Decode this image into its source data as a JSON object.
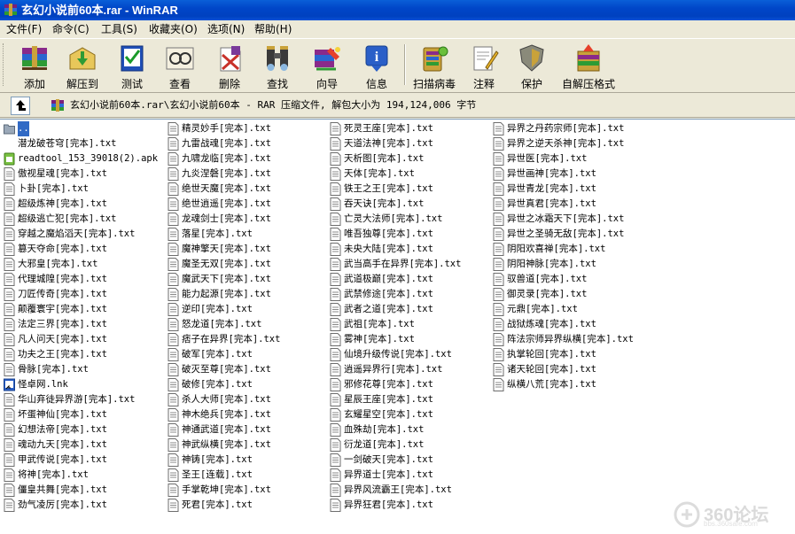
{
  "window": {
    "title": "玄幻小说前60本.rar - WinRAR"
  },
  "menu": [
    {
      "label": "文件(F)",
      "name": "menu-file"
    },
    {
      "label": "命令(C)",
      "name": "menu-command"
    },
    {
      "label": "工具(S)",
      "name": "menu-tools"
    },
    {
      "label": "收藏夹(O)",
      "name": "menu-favorites"
    },
    {
      "label": "选项(N)",
      "name": "menu-options"
    },
    {
      "label": "帮助(H)",
      "name": "menu-help"
    }
  ],
  "toolbar": {
    "add": "添加",
    "extract_to": "解压到",
    "test": "测试",
    "view": "查看",
    "delete": "删除",
    "find": "查找",
    "wizard": "向导",
    "info": "信息",
    "scan": "扫描病毒",
    "comment": "注释",
    "protect": "保护",
    "sfx": "自解压格式"
  },
  "address": {
    "path": "玄幻小说前60本.rar\\玄幻小说前60本 - RAR 压缩文件, 解包大小为 194,124,006 字节"
  },
  "files": {
    "col1": [
      {
        "name": "..",
        "icon": "folder-up-icon"
      },
      {
        "name": "潜龙破苍穹[完本].txt",
        "icon": "blank-icon"
      },
      {
        "name": "readtool_153_39018(2).apk",
        "icon": "android-icon"
      },
      {
        "name": "傲视星魂[完本].txt",
        "icon": "text-file-icon"
      },
      {
        "name": "卜卦[完本].txt",
        "icon": "text-file-icon"
      },
      {
        "name": "超级炼神[完本].txt",
        "icon": "text-file-icon"
      },
      {
        "name": "超级逃亡犯[完本].txt",
        "icon": "text-file-icon"
      },
      {
        "name": "穿越之魔焰滔天[完本].txt",
        "icon": "text-file-icon"
      },
      {
        "name": "篡天夺命[完本].txt",
        "icon": "text-file-icon"
      },
      {
        "name": "大邪皇[完本].txt",
        "icon": "text-file-icon"
      },
      {
        "name": "代理城隍[完本].txt",
        "icon": "text-file-icon"
      },
      {
        "name": "刀匠传奇[完本].txt",
        "icon": "text-file-icon"
      },
      {
        "name": "颠覆寰宇[完本].txt",
        "icon": "text-file-icon"
      },
      {
        "name": "法定三界[完本].txt",
        "icon": "text-file-icon"
      },
      {
        "name": "凡人问天[完本].txt",
        "icon": "text-file-icon"
      },
      {
        "name": "功夫之王[完本].txt",
        "icon": "text-file-icon"
      },
      {
        "name": "骨脉[完本].txt",
        "icon": "text-file-icon"
      },
      {
        "name": "怪卓网.lnk",
        "icon": "shortcut-icon"
      },
      {
        "name": "华山弃徒异界游[完本].txt",
        "icon": "text-file-icon"
      },
      {
        "name": "坏蛋神仙[完本].txt",
        "icon": "text-file-icon"
      },
      {
        "name": "幻想法帝[完本].txt",
        "icon": "text-file-icon"
      },
      {
        "name": "魂动九天[完本].txt",
        "icon": "text-file-icon"
      },
      {
        "name": "甲武传说[完本].txt",
        "icon": "text-file-icon"
      },
      {
        "name": "将神[完本].txt",
        "icon": "text-file-icon"
      },
      {
        "name": "僵皇共舞[完本].txt",
        "icon": "text-file-icon"
      },
      {
        "name": "劲气凌厉[完本].txt",
        "icon": "text-file-icon"
      }
    ],
    "col2": [
      {
        "name": "精灵妙手[完本].txt",
        "icon": "text-file-icon"
      },
      {
        "name": "九雷战魂[完本].txt",
        "icon": "text-file-icon"
      },
      {
        "name": "九啸龙临[完本].txt",
        "icon": "text-file-icon"
      },
      {
        "name": "九炎涅磐[完本].txt",
        "icon": "text-file-icon"
      },
      {
        "name": "绝世天魔[完本].txt",
        "icon": "text-file-icon"
      },
      {
        "name": "绝世逍遥[完本].txt",
        "icon": "text-file-icon"
      },
      {
        "name": "龙魂剑士[完本].txt",
        "icon": "text-file-icon"
      },
      {
        "name": "落星[完本].txt",
        "icon": "text-file-icon"
      },
      {
        "name": "魔神擎天[完本].txt",
        "icon": "text-file-icon"
      },
      {
        "name": "魔圣无双[完本].txt",
        "icon": "text-file-icon"
      },
      {
        "name": "魔武天下[完本].txt",
        "icon": "text-file-icon"
      },
      {
        "name": "能力起源[完本].txt",
        "icon": "text-file-icon"
      },
      {
        "name": "逆印[完本].txt",
        "icon": "text-file-icon"
      },
      {
        "name": "怒龙道[完本].txt",
        "icon": "text-file-icon"
      },
      {
        "name": "痞子在异界[完本].txt",
        "icon": "text-file-icon"
      },
      {
        "name": "破军[完本].txt",
        "icon": "text-file-icon"
      },
      {
        "name": "破灭至尊[完本].txt",
        "icon": "text-file-icon"
      },
      {
        "name": "破修[完本].txt",
        "icon": "text-file-icon"
      },
      {
        "name": "杀人大师[完本].txt",
        "icon": "text-file-icon"
      },
      {
        "name": "神木绝兵[完本].txt",
        "icon": "text-file-icon"
      },
      {
        "name": "神通武道[完本].txt",
        "icon": "text-file-icon"
      },
      {
        "name": "神武纵横[完本].txt",
        "icon": "text-file-icon"
      },
      {
        "name": "神铸[完本].txt",
        "icon": "text-file-icon"
      },
      {
        "name": "圣王[连载].txt",
        "icon": "text-file-icon"
      },
      {
        "name": "手掌乾坤[完本].txt",
        "icon": "text-file-icon"
      },
      {
        "name": "死君[完本].txt",
        "icon": "text-file-icon"
      }
    ],
    "col3": [
      {
        "name": "死灵王座[完本].txt",
        "icon": "text-file-icon"
      },
      {
        "name": "天道法神[完本].txt",
        "icon": "text-file-icon"
      },
      {
        "name": "天析图[完本].txt",
        "icon": "text-file-icon"
      },
      {
        "name": "天体[完本].txt",
        "icon": "text-file-icon"
      },
      {
        "name": "铁王之王[完本].txt",
        "icon": "text-file-icon"
      },
      {
        "name": "吞天诀[完本].txt",
        "icon": "text-file-icon"
      },
      {
        "name": "亡灵大法师[完本].txt",
        "icon": "text-file-icon"
      },
      {
        "name": "唯吾独尊[完本].txt",
        "icon": "text-file-icon"
      },
      {
        "name": "未央大陆[完本].txt",
        "icon": "text-file-icon"
      },
      {
        "name": "武当高手在异界[完本].txt",
        "icon": "text-file-icon"
      },
      {
        "name": "武道极巅[完本].txt",
        "icon": "text-file-icon"
      },
      {
        "name": "武禁修途[完本].txt",
        "icon": "text-file-icon"
      },
      {
        "name": "武者之道[完本].txt",
        "icon": "text-file-icon"
      },
      {
        "name": "武祖[完本].txt",
        "icon": "text-file-icon"
      },
      {
        "name": "雾神[完本].txt",
        "icon": "text-file-icon"
      },
      {
        "name": "仙境升级传说[完本].txt",
        "icon": "text-file-icon"
      },
      {
        "name": "逍遥异界行[完本].txt",
        "icon": "text-file-icon"
      },
      {
        "name": "邪修花尊[完本].txt",
        "icon": "text-file-icon"
      },
      {
        "name": "星辰王座[完本].txt",
        "icon": "text-file-icon"
      },
      {
        "name": "玄耀星空[完本].txt",
        "icon": "text-file-icon"
      },
      {
        "name": "血殊劫[完本].txt",
        "icon": "text-file-icon"
      },
      {
        "name": "衍龙道[完本].txt",
        "icon": "text-file-icon"
      },
      {
        "name": "一剑破天[完本].txt",
        "icon": "text-file-icon"
      },
      {
        "name": "异界道士[完本].txt",
        "icon": "text-file-icon"
      },
      {
        "name": "异界风流霸王[完本].txt",
        "icon": "text-file-icon"
      },
      {
        "name": "异界狂君[完本].txt",
        "icon": "text-file-icon"
      }
    ],
    "col4": [
      {
        "name": "异界之丹药宗师[完本].txt",
        "icon": "text-file-icon"
      },
      {
        "name": "异界之逆天杀神[完本].txt",
        "icon": "text-file-icon"
      },
      {
        "name": "异世医[完本].txt",
        "icon": "text-file-icon"
      },
      {
        "name": "异世画神[完本].txt",
        "icon": "text-file-icon"
      },
      {
        "name": "异世青龙[完本].txt",
        "icon": "text-file-icon"
      },
      {
        "name": "异世真君[完本].txt",
        "icon": "text-file-icon"
      },
      {
        "name": "异世之冰霜天下[完本].txt",
        "icon": "text-file-icon"
      },
      {
        "name": "异世之圣骑无敌[完本].txt",
        "icon": "text-file-icon"
      },
      {
        "name": "阴阳欢喜禅[完本].txt",
        "icon": "text-file-icon"
      },
      {
        "name": "阴阳神脉[完本].txt",
        "icon": "text-file-icon"
      },
      {
        "name": "驭兽道[完本].txt",
        "icon": "text-file-icon"
      },
      {
        "name": "御灵录[完本].txt",
        "icon": "text-file-icon"
      },
      {
        "name": "元鼎[完本].txt",
        "icon": "text-file-icon"
      },
      {
        "name": "战狱炼魂[完本].txt",
        "icon": "text-file-icon"
      },
      {
        "name": "阵法宗师异界纵横[完本].txt",
        "icon": "text-file-icon"
      },
      {
        "name": "执掌轮回[完本].txt",
        "icon": "text-file-icon"
      },
      {
        "name": "诸天轮回[完本].txt",
        "icon": "text-file-icon"
      },
      {
        "name": "纵横八荒[完本].txt",
        "icon": "text-file-icon"
      }
    ]
  },
  "watermark": {
    "brand": "360论坛",
    "site": "bbs.360safe.com"
  }
}
